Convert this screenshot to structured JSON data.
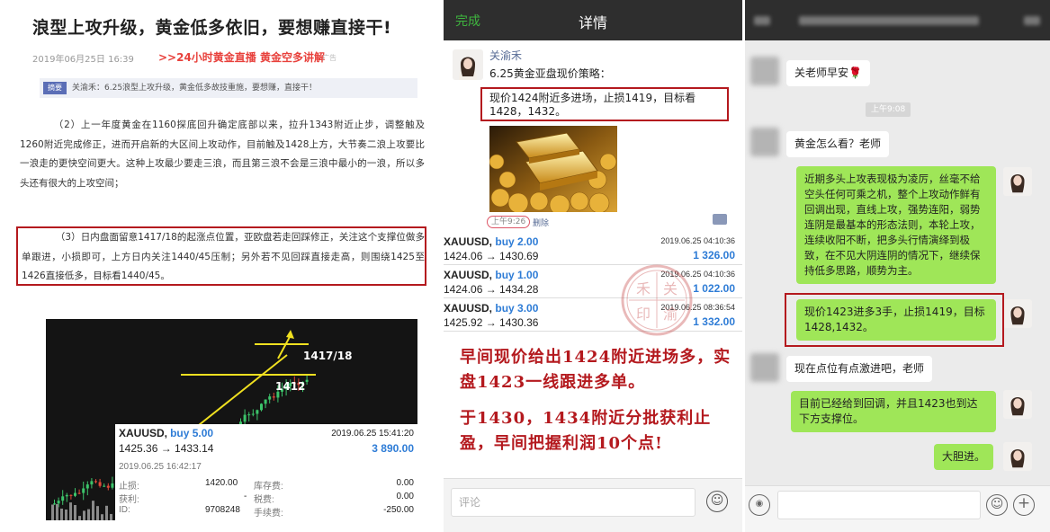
{
  "article": {
    "title": "浪型上攻升级，黄金低多依旧，要想赚直接干!",
    "date": "2019年06月25日 16:39",
    "live_link": ">>24小时黄金直播 黄金空多讲解",
    "ad_label": "广告",
    "abstract_tag": "摘要",
    "abstract_text": "关渝禾：6.25浪型上攻升级，黄金低多故技重施，要想赚，直接干！",
    "para1": "（2）上一年度黄金在1160探底回升确定底部以来，拉升1343附近止步，调整触及1260附近完成修正，进而开启新的大区间上攻动作，目前触及1428上方，大节奏二浪上攻要比一浪走的更快空间更大。这种上攻最少要走三浪，而且第三浪不会是三浪中最小的一浪，所以多头还有很大的上攻空间；",
    "para2": "（3）日内盘面留意1417/18的起涨点位置，亚欧盘若走回踩修正，关注这个支撑位做多单跟进，小损即可，上方日内关注1440/45压制；另外若不见回踩直接走高，则围绕1425至1426直接低多，目标看1440/45。",
    "chart_label_1": "1417/18",
    "chart_label_2": "1412",
    "trade": {
      "symbol": "XAUUSD,",
      "side": "buy 5.00",
      "datetime": "2019.06.25 15:41:20",
      "prices": "1425.36 → 1433.14",
      "profit": "3 890.00",
      "close_time": "2019.06.25 16:42:17",
      "rows": [
        {
          "k1": "止损:",
          "v1": "1420.00",
          "k2": "库存费:",
          "v2": "0.00"
        },
        {
          "k1": "获利:",
          "v1": "-",
          "k2": "税费:",
          "v2": "0.00"
        },
        {
          "k1": "ID:",
          "v1": "9708248",
          "k2": "手续费:",
          "v2": "-250.00"
        }
      ]
    }
  },
  "moments": {
    "nav_done": "完成",
    "nav_title": "详情",
    "user": "关渝禾",
    "post_text": "6.25黄金亚盘现价策略：",
    "box_text": "现价1424附近多进场，止损1419，目标看1428，1432。",
    "post_time": "上午9:26",
    "delete_label": "删除",
    "trades": [
      {
        "symbol": "XAUUSD,",
        "side": "buy 2.00",
        "datetime": "2019.06.25 04:10:36",
        "prices": "1424.06 → 1430.69",
        "profit": "1 326.00"
      },
      {
        "symbol": "XAUUSD,",
        "side": "buy 1.00",
        "datetime": "2019.06.25 04:10:36",
        "prices": "1424.06 → 1434.28",
        "profit": "1 022.00"
      },
      {
        "symbol": "XAUUSD,",
        "side": "buy 3.00",
        "datetime": "2019.06.25 08:36:54",
        "prices": "1425.92 → 1430.36",
        "profit": "1 332.00"
      }
    ],
    "seal_chars": [
      "禾",
      "关",
      "渝",
      "印"
    ],
    "calligraphy_1": "早间现价给出1424附近进场多，实盘1423一线跟进多单。",
    "calligraphy_2": "于1430，1434附近分批获利止盈，早间把握利润10个点!",
    "comment_placeholder": "评论",
    "emoji_icon": "☺"
  },
  "chat": {
    "timestamp": "上午9:08",
    "messages": [
      {
        "side": "left",
        "text": "关老师早安🌹"
      },
      {
        "side": "left",
        "text": "黄金怎么看？老师"
      },
      {
        "side": "right",
        "text": "近期多头上攻表现极为凌厉，丝毫不给空头任何可乘之机，整个上攻动作鲜有回调出现，直线上攻，强势连阳，弱势连阴是最基本的形态法则，本轮上攻，连续收阳不断，把多头行情演绎到极致，在不见大阴连阴的情况下，继续保持低多思路，顺势为主。"
      },
      {
        "side": "right",
        "text": "现价1423进多3手，止损1419，目标1428,1432。"
      },
      {
        "side": "left",
        "text": "现在点位有点激进吧，老师"
      },
      {
        "side": "right",
        "text": "目前已经给到回调，并且1423也到达下方支撑位。"
      },
      {
        "side": "right",
        "text": "大胆进。"
      }
    ],
    "voice_icon": "◉",
    "emoji_icon": "☺",
    "plus_icon": "+"
  },
  "colors": {
    "highlight_border": "#b4191e",
    "wechat_green": "#9fe658",
    "trade_blue": "#2e7cd6",
    "link_red": "#e8413c"
  }
}
